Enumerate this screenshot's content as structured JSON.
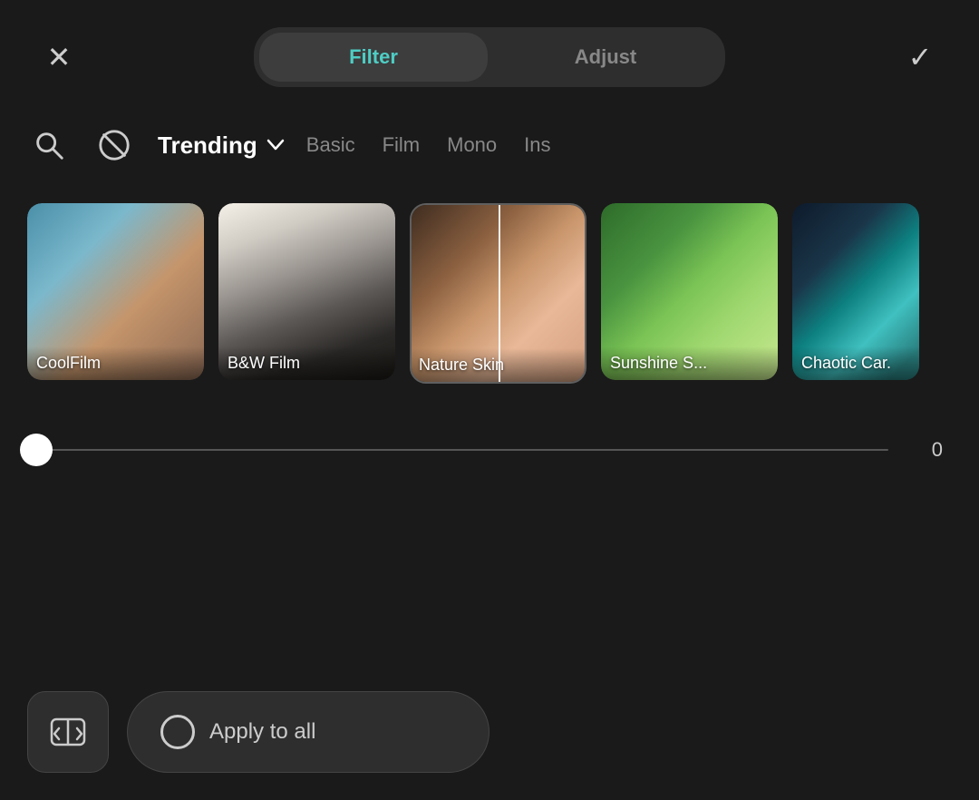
{
  "header": {
    "close_label": "×",
    "check_label": "✓",
    "tabs": [
      {
        "id": "filter",
        "label": "Filter",
        "active": true
      },
      {
        "id": "adjust",
        "label": "Adjust",
        "active": false
      }
    ]
  },
  "filter_bar": {
    "trending_label": "Trending",
    "categories": [
      "Basic",
      "Film",
      "Mono",
      "Ins"
    ]
  },
  "filters": [
    {
      "id": "coolfilm",
      "label": "CoolFilm",
      "class": "thumb-coolfilm"
    },
    {
      "id": "bwfilm",
      "label": "B&W Film",
      "class": "thumb-bwfilm"
    },
    {
      "id": "natureskin",
      "label": "Nature Skin",
      "class": "thumb-natureskin",
      "selected": true
    },
    {
      "id": "sunshine",
      "label": "Sunshine S...",
      "class": "thumb-sunshine"
    },
    {
      "id": "chaotic",
      "label": "Chaotic Car.",
      "class": "thumb-chaotic",
      "partial": true
    }
  ],
  "slider": {
    "value": "0",
    "min": 0,
    "max": 100,
    "current": 0
  },
  "bottom": {
    "apply_all_label": "Apply to all"
  }
}
